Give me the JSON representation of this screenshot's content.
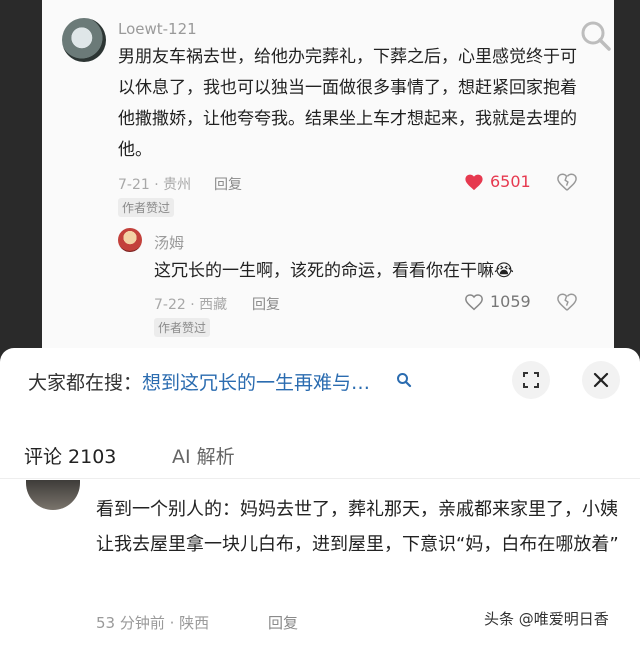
{
  "comment1": {
    "username": "Loewt-121",
    "text": "男朋友车祸去世，给他办完葬礼，下葬之后，心里感觉终于可以休息了，我也可以独当一面做很多事情了，想赶紧回家抱着他撒撒娇，让他夸夸我。结果坐上车才想起来，我就是去埋的他。",
    "date_location": "7-21 · 贵州",
    "reply_label": "回复",
    "badge": "作者赞过",
    "likes": "6501"
  },
  "reply1": {
    "username": "汤姆",
    "text": "这冗长的一生啊，该死的命运，看看你在干嘛😭",
    "date_location": "7-22 · 西藏",
    "reply_label": "回复",
    "badge": "作者赞过",
    "likes": "1059"
  },
  "search_bar": {
    "prefix": "大家都在搜：",
    "query": "想到这冗长的一生再难与…"
  },
  "tabs": [
    {
      "label": "评论 2103",
      "active": true
    },
    {
      "label": "AI 解析",
      "active": false
    }
  ],
  "comment2": {
    "text": "看到一个别人的：妈妈去世了，葬礼那天，亲戚都来家里了，小姨让我去屋里拿一块儿白布，进到屋里，下意识“妈，白布在哪放着”",
    "date_location": "53 分钟前 · 陕西",
    "reply_label": "回复"
  },
  "watermark": "头条 @唯爱明日香",
  "colors": {
    "like_active": "#e6394f",
    "link_blue": "#2b6cb0"
  }
}
